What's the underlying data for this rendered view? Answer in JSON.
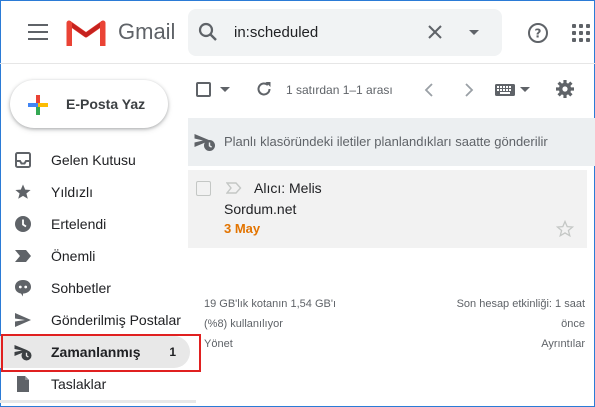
{
  "header": {
    "brand": "Gmail",
    "search_value": "in:scheduled"
  },
  "compose": {
    "label": "E-Posta Yaz"
  },
  "sidebar": {
    "items": [
      {
        "label": "Gelen Kutusu",
        "icon": "inbox-icon"
      },
      {
        "label": "Yıldızlı",
        "icon": "star-icon"
      },
      {
        "label": "Ertelendi",
        "icon": "clock-icon"
      },
      {
        "label": "Önemli",
        "icon": "important-icon"
      },
      {
        "label": "Sohbetler",
        "icon": "chat-icon"
      },
      {
        "label": "Gönderilmiş Postalar",
        "icon": "send-icon"
      },
      {
        "label": "Zamanlanmış",
        "icon": "scheduled-send-icon",
        "count": "1"
      },
      {
        "label": "Taslaklar",
        "icon": "draft-icon"
      }
    ]
  },
  "toolbar": {
    "pagination": "1 satırdan 1–1 arası"
  },
  "banner": {
    "text": "Planlı klasöründeki iletiler planlandıkları saatte gönderilir"
  },
  "message": {
    "to": "Alıcı: Melis",
    "subject": "Sordum.net",
    "date": "3 May"
  },
  "footer": {
    "storage_line1": "19 GB'lık kotanın 1,54 GB'ı",
    "storage_line2": "(%8) kullanılıyor",
    "manage": "Yönet",
    "activity_line1": "Son hesap etkinliği: 1 saat",
    "activity_line2": "önce",
    "details": "Ayrıntılar"
  },
  "colors": {
    "date_accent": "#e37400",
    "highlight_border": "#e02020",
    "window_border": "#2b7bd6"
  }
}
